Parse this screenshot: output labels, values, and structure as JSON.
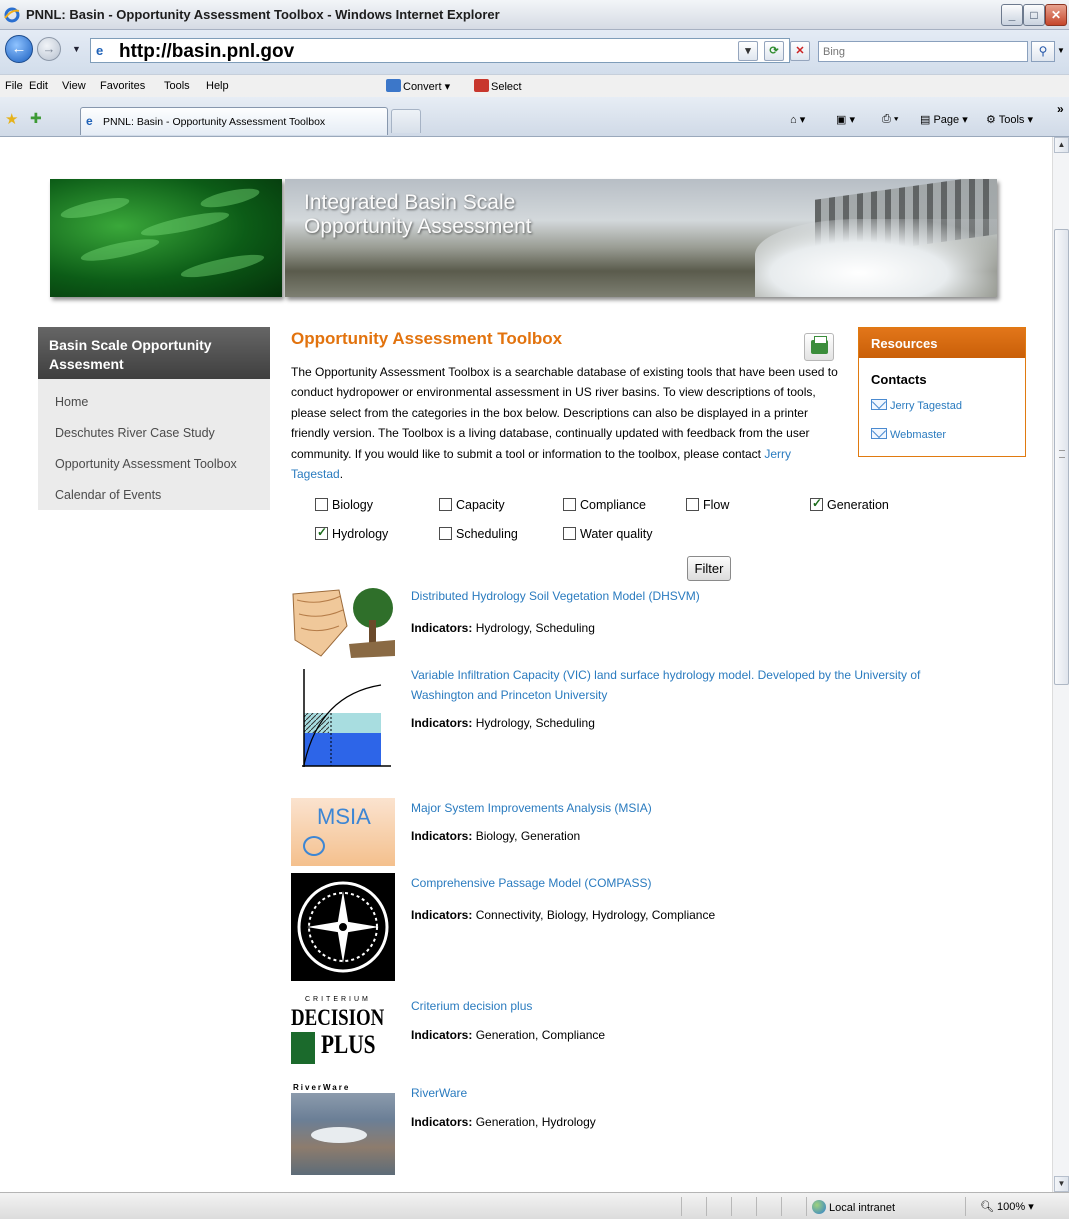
{
  "window": {
    "title": "PNNL: Basin - Opportunity Assessment Toolbox - Windows Internet Explorer"
  },
  "address": {
    "url": "http://basin.pnl.gov",
    "search_placeholder": "Bing"
  },
  "menu": [
    "File",
    "Edit",
    "View",
    "Favorites",
    "Tools",
    "Help"
  ],
  "toolbar": {
    "convert": "Convert",
    "select": "Select"
  },
  "tab": {
    "label": "PNNL: Basin - Opportunity Assessment Toolbox"
  },
  "commands": {
    "page": "Page",
    "tools": "Tools"
  },
  "banner": {
    "line1": "Integrated Basin Scale",
    "line2": "Opportunity Assessment"
  },
  "leftnav": {
    "heading": "Basin Scale Opportunity Assesment",
    "links": [
      "Home",
      "Deschutes River Case Study",
      "Opportunity Assessment Toolbox",
      "Calendar of Events"
    ]
  },
  "main": {
    "title": "Opportunity Assessment Toolbox",
    "intro": "The Opportunity Assessment Toolbox is a searchable database of existing tools that have been used to conduct hydropower or environmental assessment in US river basins. To view descriptions of tools, please select from the categories in the box below. Descriptions can also be displayed in a printer friendly version. The Toolbox is a living database, continually updated with feedback from the user community. If you would like to submit a tool or information to the toolbox, please contact ",
    "intro_link": "Jerry Tagestad",
    "intro_end": ".",
    "filter_label": "Filter",
    "categories": [
      {
        "label": "Biology",
        "checked": false
      },
      {
        "label": "Capacity",
        "checked": false
      },
      {
        "label": "Compliance",
        "checked": false
      },
      {
        "label": "Flow",
        "checked": false
      },
      {
        "label": "Generation",
        "checked": true
      },
      {
        "label": "Hydrology",
        "checked": true
      },
      {
        "label": "Scheduling",
        "checked": false
      },
      {
        "label": "Water quality",
        "checked": false
      }
    ],
    "indicators_label": "Indicators:",
    "tools": [
      {
        "name": "Distributed Hydrology Soil Vegetation Model (DHSVM)",
        "indicators": "Hydrology, Scheduling"
      },
      {
        "name": "Variable Infiltration Capacity (VIC) land surface hydrology model. Developed by the University of Washington and Princeton University",
        "indicators": "Hydrology, Scheduling"
      },
      {
        "name": "Major System Improvements Analysis (MSIA)",
        "indicators": "Biology, Generation",
        "thumb_text": "MSIA"
      },
      {
        "name": "Comprehensive Passage Model (COMPASS)",
        "indicators": "Connectivity, Biology, Hydrology, Compliance"
      },
      {
        "name": "Criterium decision plus",
        "indicators": "Generation, Compliance",
        "thumb_text": [
          "CRITERIUM",
          "DECISION",
          "PLUS"
        ]
      },
      {
        "name": "RiverWare",
        "indicators": "Generation, Hydrology",
        "thumb_text": "RiverWare"
      }
    ]
  },
  "resources": {
    "heading": "Resources",
    "sub": "Contacts",
    "links": [
      "Jerry Tagestad",
      "Webmaster"
    ]
  },
  "status": {
    "zone": "Local intranet",
    "zoom": "100%"
  },
  "colors": {
    "accent": "#e2730e",
    "link": "#2a7bbf",
    "nav_head": "#4f4f4f"
  }
}
